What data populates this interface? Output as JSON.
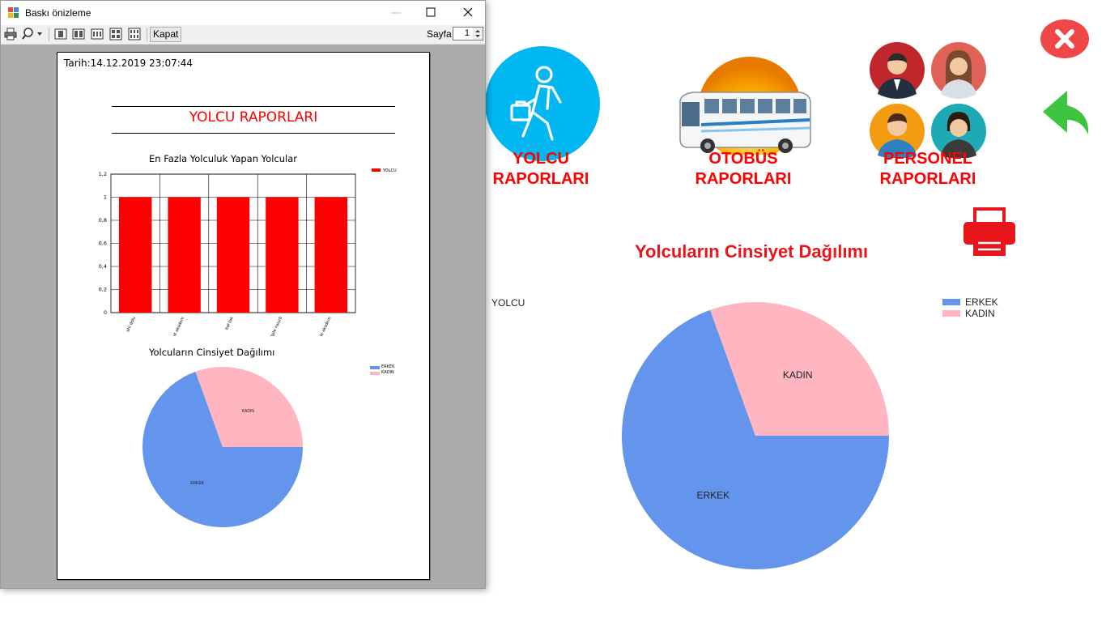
{
  "window": {
    "title": "Baskı önizleme",
    "close_label": "Kapat",
    "page_label": "Sayfa",
    "page_value": "1"
  },
  "report": {
    "date": "Tarih:14.12.2019 23:07:44",
    "header": "YOLCU RAPORLARI",
    "bar_chart": {
      "title": "En Fazla Yolculuk Yapan Yolcular",
      "legend": "YOLCU",
      "color": "#ff0000",
      "y_ticks": [
        "1,2",
        "1",
        "0,8",
        "0,6",
        "0,4",
        "0,2",
        "0"
      ],
      "ylim": [
        0,
        1.2
      ],
      "categories": [
        "ahi dolu",
        "murhat akadem",
        "bal tak",
        "polgile nasırli",
        "serkle akadem"
      ],
      "values": [
        1,
        1,
        1,
        1,
        1
      ]
    },
    "pie_chart": {
      "title": "Yolcuların Cinsiyet Dağılımı",
      "slices": [
        {
          "label": "ERKEK",
          "value": 0.695,
          "color": "#6495ed"
        },
        {
          "label": "KADIN",
          "value": 0.305,
          "color": "#ffb6c1"
        }
      ]
    }
  },
  "app": {
    "nav": [
      {
        "label_line1": "YOLCU",
        "label_line2": "RAPORLARI",
        "icon": "passenger-icon"
      },
      {
        "label_line1": "OTOBÜS",
        "label_line2": "RAPORLARI",
        "icon": "bus-icon"
      },
      {
        "label_line1": "PERSONEL",
        "label_line2": "RAPORLARI",
        "icon": "staff-icon"
      }
    ],
    "chart_title": "Yolcuların Cinsiyet Dağılımı",
    "partial_legend": "YOLCU",
    "icons": [
      "close-icon",
      "back-arrow-icon",
      "printer-icon"
    ],
    "accent_color": "#ff0000"
  },
  "chart_data": [
    {
      "type": "pie",
      "title": "Yolcuların Cinsiyet Dağılımı",
      "categories": [
        "ERKEK",
        "KADIN"
      ],
      "values": [
        0.695,
        0.305
      ],
      "colors": [
        "#6495ed",
        "#ffb6c1"
      ],
      "legend": "top-right"
    },
    {
      "type": "bar",
      "title": "En Fazla Yolculuk Yapan Yolcular",
      "categories": [
        "ahi dolu",
        "murhat akadem",
        "bal tak",
        "polgile nasırli",
        "serkle akadem"
      ],
      "series": [
        {
          "name": "YOLCU",
          "values": [
            1,
            1,
            1,
            1,
            1
          ]
        }
      ],
      "ylim": [
        0,
        1.2
      ],
      "legend": "top-right"
    }
  ]
}
